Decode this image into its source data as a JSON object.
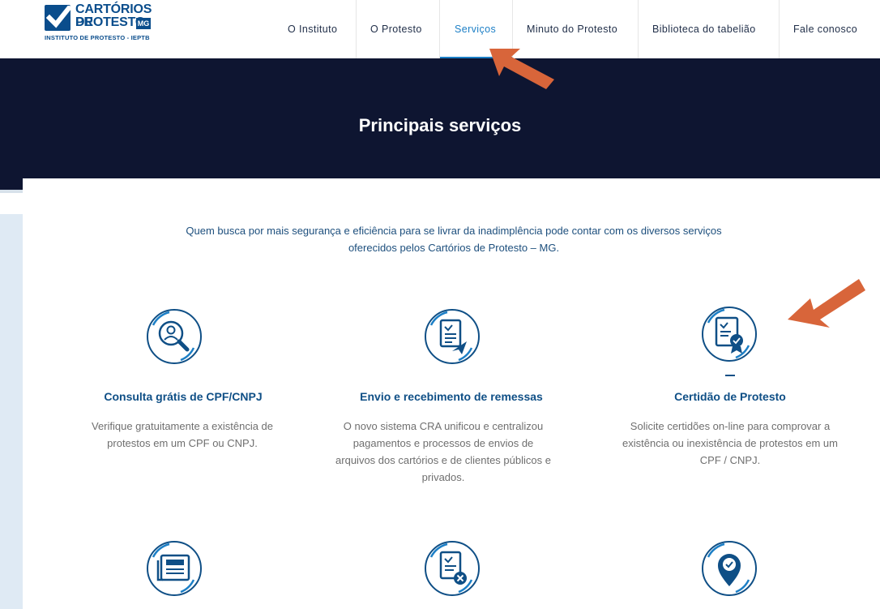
{
  "logo": {
    "line1": "CARTÓRIOS DE",
    "line2": "PROTESTO",
    "badge": "MG",
    "tagline": "INSTITUTO DE PROTESTO - IEPTB"
  },
  "nav": {
    "items": [
      {
        "label": "O Instituto"
      },
      {
        "label": "O Protesto"
      },
      {
        "label": "Serviços",
        "active": true
      },
      {
        "label": "Minuto do Protesto"
      },
      {
        "label": "Biblioteca do tabelião"
      },
      {
        "label": "Fale conosco"
      }
    ]
  },
  "hero": {
    "title": "Principais serviços"
  },
  "intro": {
    "line1": "Quem busca por mais segurança e eficiência para se livrar da inadimplência pode contar com os diversos serviços",
    "line2": "oferecidos pelos Cartórios de Protesto – MG."
  },
  "services": [
    {
      "icon": "search-person-icon",
      "title": "Consulta grátis de CPF/CNPJ",
      "desc": [
        "Verifique gratuitamente a existência de",
        "protestos em um CPF ou CNPJ."
      ]
    },
    {
      "icon": "document-send-icon",
      "title": "Envio e recebimento de remessas",
      "desc": [
        "O novo sistema CRA unificou e centralizou",
        "pagamentos e processos de envios de",
        "arquivos dos cartórios e de clientes públicos e",
        "privados."
      ]
    },
    {
      "icon": "certificate-icon",
      "title": "Certidão de Protesto",
      "desc": [
        "Solicite certidões on-line para comprovar a",
        "existência ou inexistência de protestos em um",
        "CPF / CNPJ."
      ]
    },
    {
      "icon": "edital-newspaper-icon"
    },
    {
      "icon": "document-cancel-icon"
    },
    {
      "icon": "location-check-icon"
    }
  ],
  "colors": {
    "brand": "#0a4d8c",
    "hero_bg": "#0e1531",
    "accent": "#1c7fc6",
    "arrow": "#d8653a",
    "service_title": "#0f4f86"
  }
}
